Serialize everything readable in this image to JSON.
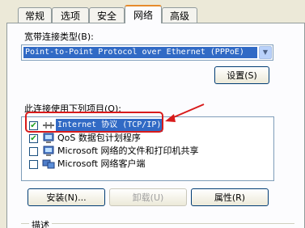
{
  "tabs": [
    {
      "label": "常规"
    },
    {
      "label": "选项"
    },
    {
      "label": "安全"
    },
    {
      "label": "网络"
    },
    {
      "label": "高级"
    }
  ],
  "active_tab": "网络",
  "connection_type": {
    "label": "宽带连接类型(B):",
    "value": "Point-to-Point Protocol over Ethernet (PPPoE)"
  },
  "settings_button": "设置(S)",
  "components": {
    "label": "此连接使用下列项目(O):",
    "items": [
      {
        "label": "Internet 协议 (TCP/IP)",
        "checked": true,
        "selected": true,
        "icon": "network-protocol-icon"
      },
      {
        "label": "QoS 数据包计划程序",
        "checked": true,
        "selected": false,
        "icon": "network-service-icon"
      },
      {
        "label": "Microsoft 网络的文件和打印机共享",
        "checked": false,
        "selected": false,
        "icon": "network-service-icon"
      },
      {
        "label": "Microsoft 网络客户端",
        "checked": false,
        "selected": false,
        "icon": "network-client-icon"
      }
    ]
  },
  "buttons": {
    "install": "安装(N)...",
    "uninstall": "卸载(U)",
    "properties": "属性(R)"
  },
  "description_label": "描述",
  "annotation": {
    "color": "#d81b1b"
  }
}
